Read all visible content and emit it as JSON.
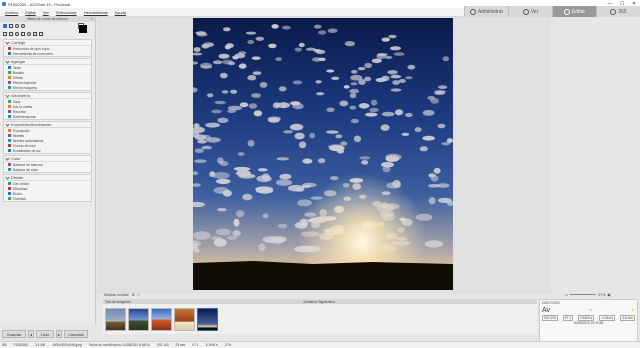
{
  "window": {
    "title": "P1060250 - ACDSee 15 - Procesar",
    "controls": [
      "—",
      "☐",
      "✕"
    ]
  },
  "menu": [
    "Archivo",
    "Editar",
    "Ver",
    "Seleccionar",
    "Herramientas",
    "Ayuda"
  ],
  "modes": [
    {
      "label": "Administrar",
      "active": false
    },
    {
      "label": "Ver",
      "active": false
    },
    {
      "label": "Editar",
      "active": true
    },
    {
      "label": "365",
      "active": false
    }
  ],
  "left_panel": {
    "header": "Menú de modo de edición",
    "close": "×",
    "groups": [
      {
        "title": "Corregir",
        "items": [
          "Reducción de ojos rojos",
          "Herramienta de corrección"
        ]
      },
      {
        "title": "Agregar",
        "items": [
          "Texto",
          "Bordes",
          "Viñeta",
          "Efecto especial",
          "Efecto maqueta"
        ]
      },
      {
        "title": "Geometría",
        "items": [
          "Girar",
          "Dar la vuelta",
          "Recortar",
          "Redimensionar"
        ]
      },
      {
        "title": "Exposición/iluminación",
        "items": [
          "Exposición",
          "Niveles",
          "Niveles automáticos",
          "Curvas de tono",
          "Ecualizador de luz"
        ]
      },
      {
        "title": "Color",
        "items": [
          "Balance de blancos",
          "Balance de color"
        ]
      },
      {
        "title": "Detalle",
        "items": [
          "Dar nitidez",
          "Difuminar",
          "Ruido",
          "Claridad"
        ]
      }
    ],
    "buttons": {
      "save": "Guardar",
      "prev": "◂",
      "done": "Listo",
      "next": "▸",
      "cancel": "Cancelar"
    }
  },
  "filmstrip": {
    "show_label": "Mostrar ocultos",
    "tab_label": "Tira de imágenes",
    "nav": "◂ Anterior     Siguiente ▸"
  },
  "zoom": {
    "value": "27%"
  },
  "exif": {
    "camera": "DMC-FZ200",
    "mode": "Av",
    "iso": "ISO 100",
    "aperture": "f/7.1",
    "shutter": "1/1600 s",
    "ev": "-0.66 eV",
    "focal": "4.5 mm",
    "date": "20/08/2013 19:20:36"
  },
  "status": {
    "index": "8/8",
    "filename": "P1060250",
    "size": "3.4 MB",
    "dims": "4000x3000x24b jpeg",
    "modified": "Fecha de modificación: 21/08/2013 8:48:34",
    "iso": "ISO 100",
    "focal": "25 mm",
    "aperture": "f/7.1",
    "shutter": "1/1600 s",
    "zoom": "27%"
  },
  "colors": {
    "accent": "#2b6fd1"
  }
}
